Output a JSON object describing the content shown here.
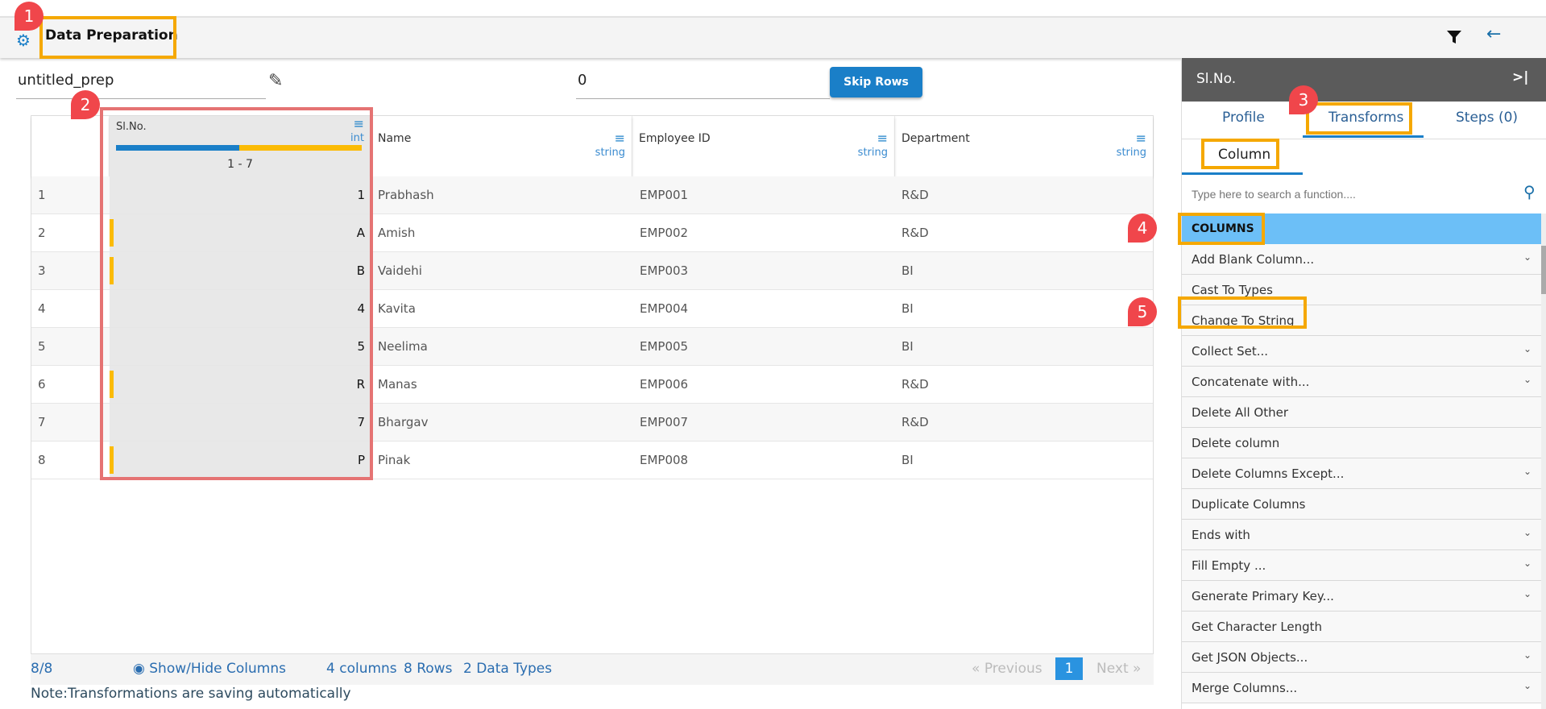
{
  "header": {
    "title": "Data Preparation",
    "filter_icon": "filter-icon",
    "back_icon": "arrow-left-icon"
  },
  "prep_name": "untitled_prep",
  "skip_rows_value": "0",
  "skip_rows_label": "Skip Rows",
  "columns": [
    {
      "name": "Sl.No.",
      "type": "int",
      "range": "1 - 7",
      "profile_bar": {
        "blue_fraction": 0.5,
        "yellow_fraction": 0.5
      }
    },
    {
      "name": "Name",
      "type": "string"
    },
    {
      "name": "Employee ID",
      "type": "string"
    },
    {
      "name": "Department",
      "type": "string"
    }
  ],
  "rows": [
    {
      "idx": "1",
      "sl": "1",
      "name": "Prabhash",
      "emp": "EMP001",
      "dept": "R&D",
      "flag": false
    },
    {
      "idx": "2",
      "sl": "A",
      "name": "Amish",
      "emp": "EMP002",
      "dept": "R&D",
      "flag": true
    },
    {
      "idx": "3",
      "sl": "B",
      "name": "Vaidehi",
      "emp": "EMP003",
      "dept": "BI",
      "flag": true
    },
    {
      "idx": "4",
      "sl": "4",
      "name": "Kavita",
      "emp": "EMP004",
      "dept": "BI",
      "flag": false
    },
    {
      "idx": "5",
      "sl": "5",
      "name": "Neelima",
      "emp": "EMP005",
      "dept": "BI",
      "flag": false
    },
    {
      "idx": "6",
      "sl": "R",
      "name": "Manas",
      "emp": "EMP006",
      "dept": "R&D",
      "flag": true
    },
    {
      "idx": "7",
      "sl": "7",
      "name": "Bhargav",
      "emp": "EMP007",
      "dept": "R&D",
      "flag": false
    },
    {
      "idx": "8",
      "sl": "P",
      "name": "Pinak",
      "emp": "EMP008",
      "dept": "BI",
      "flag": true
    }
  ],
  "footer": {
    "count": "8/8",
    "show_hide": "Show/Hide Columns",
    "columns": "4 columns",
    "rows": "8 Rows",
    "types": "2 Data Types",
    "prev": "Previous",
    "page": "1",
    "next": "Next",
    "note": "Note:Transformations are saving automatically"
  },
  "panel": {
    "title": "Sl.No.",
    "tabs": [
      "Profile",
      "Transforms",
      "Steps (0)"
    ],
    "subtab": "Column",
    "search_placeholder": "Type here to search a function....",
    "section": "COLUMNS",
    "items": [
      {
        "label": "Add Blank Column...",
        "expand": true
      },
      {
        "label": "Cast To Types",
        "expand": false
      },
      {
        "label": "Change To String",
        "expand": false
      },
      {
        "label": "Collect Set...",
        "expand": true
      },
      {
        "label": "Concatenate with...",
        "expand": true
      },
      {
        "label": "Delete All Other",
        "expand": false
      },
      {
        "label": "Delete column",
        "expand": false
      },
      {
        "label": "Delete Columns Except...",
        "expand": true
      },
      {
        "label": "Duplicate Columns",
        "expand": false
      },
      {
        "label": "Ends with",
        "expand": true
      },
      {
        "label": "Fill Empty ...",
        "expand": true
      },
      {
        "label": "Generate Primary Key...",
        "expand": true
      },
      {
        "label": "Get Character Length",
        "expand": false
      },
      {
        "label": "Get JSON Objects...",
        "expand": true
      },
      {
        "label": "Merge Columns...",
        "expand": true
      }
    ]
  },
  "annotations": [
    "1",
    "2",
    "3",
    "4",
    "5"
  ],
  "colors": {
    "accent": "#1a7fc8",
    "highlight": "#f5a800",
    "badge": "#f0464b",
    "section": "#6cbff7"
  }
}
